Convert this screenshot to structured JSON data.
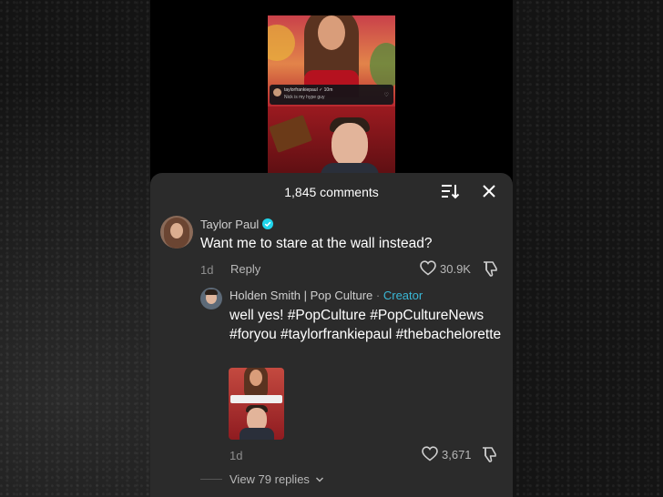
{
  "video": {
    "overlay_username": "taylorfrankiepaul ✓ 10m",
    "overlay_comment": "Nick is my hype guy"
  },
  "header": {
    "comments_count": "1,845 comments",
    "sort_icon": "sort-icon",
    "close_icon": "close-icon"
  },
  "comment": {
    "username": "Taylor Paul",
    "verified": true,
    "text": "Want me to stare at the wall instead?",
    "date": "1d",
    "reply_label": "Reply",
    "likes": "30.9K"
  },
  "reply": {
    "username": "Holden Smith | Pop Culture",
    "separator": " · ",
    "badge": "Creator",
    "text": "well yes! #PopCulture #PopCultureNews #foryou #taylorfrankiepaul #thebachelorette",
    "date": "1d",
    "likes": "3,671"
  },
  "view_replies": {
    "label": "View 79 replies"
  },
  "colors": {
    "sheet_bg": "#2b2b2b",
    "creator_accent": "#3ab8d6",
    "verified": "#20d5ec"
  }
}
